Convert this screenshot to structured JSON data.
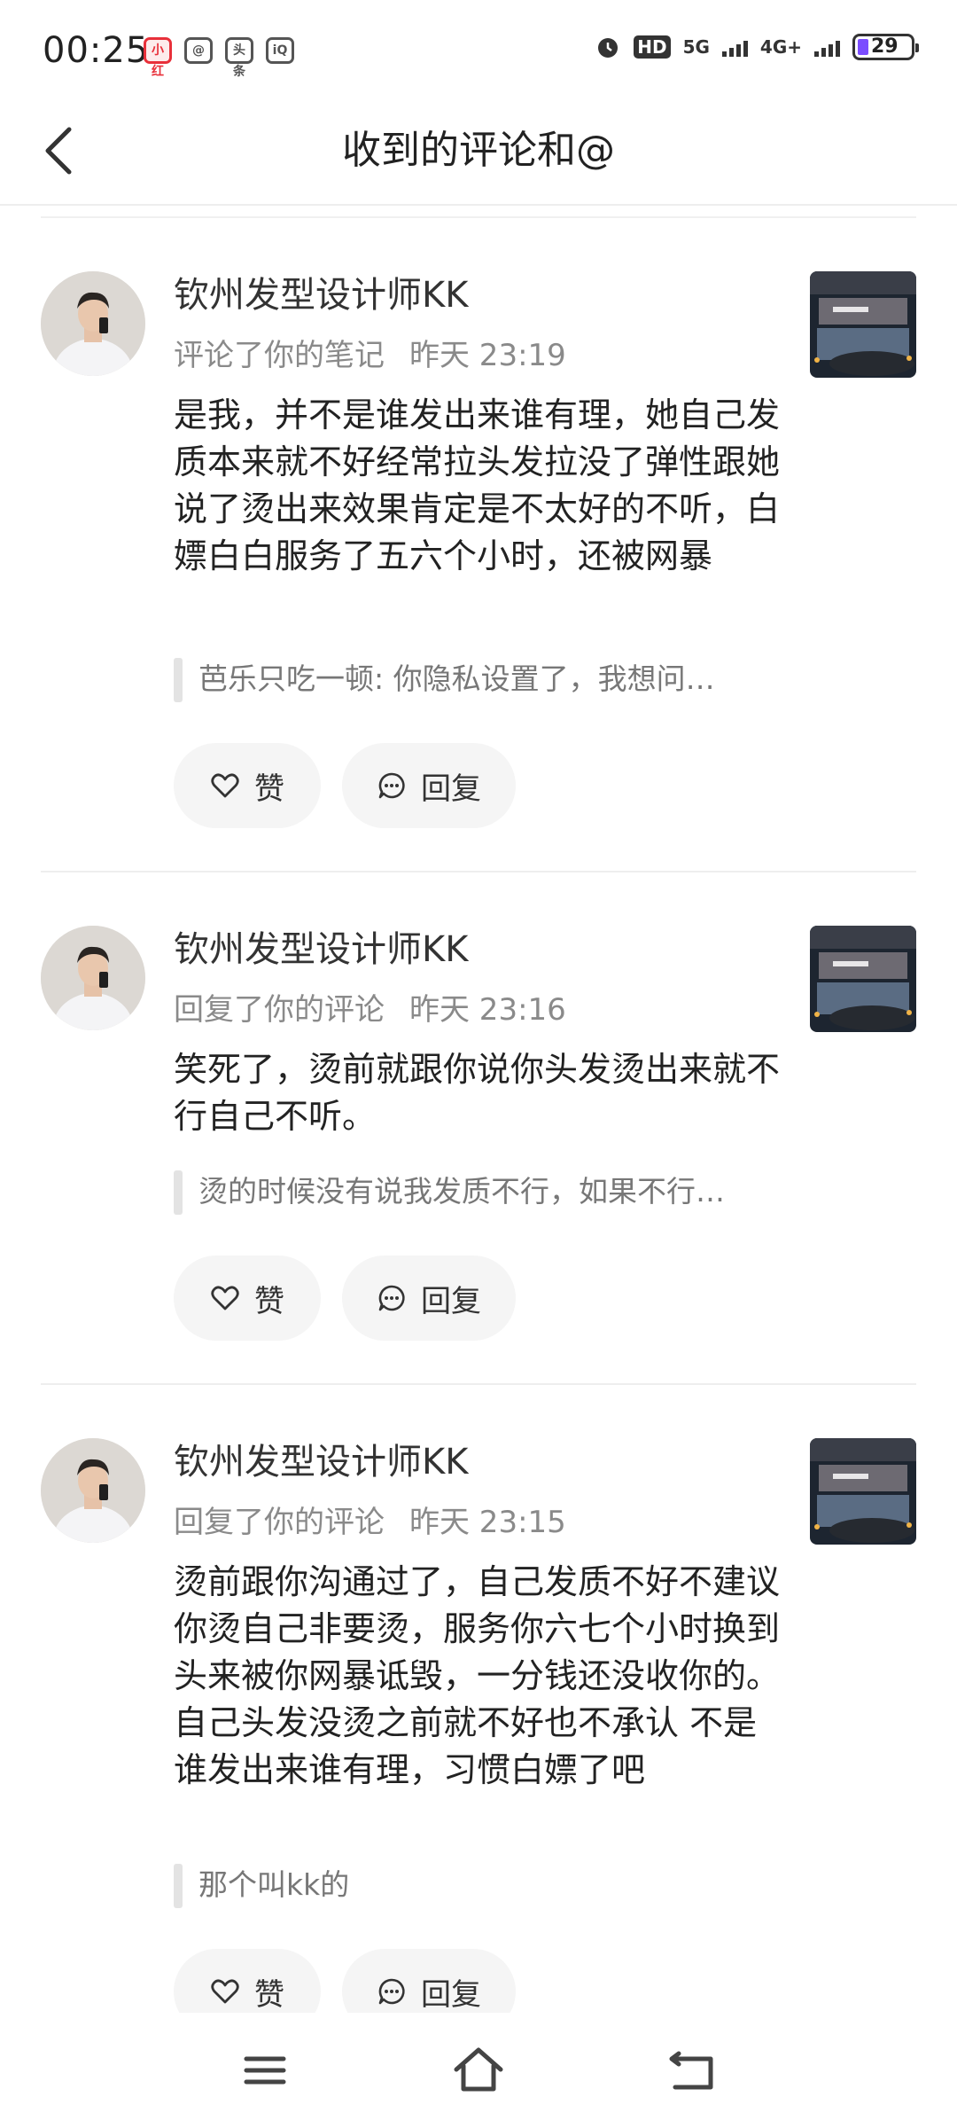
{
  "status_bar": {
    "time": "00:25",
    "app_icons": [
      "小红书",
      "@",
      "头条",
      "iQIYI"
    ],
    "hd_label": "HD",
    "network_5g": "5G",
    "network_4g": "4G+",
    "battery": "29"
  },
  "header": {
    "title": "收到的评论和@"
  },
  "items": [
    {
      "username": "钦州发型设计师KK",
      "action": "评论了你的笔记",
      "time": "昨天 23:19",
      "content": "是我，并不是谁发出来谁有理，她自己发质本来就不好经常拉头发拉没了弹性跟她说了烫出来效果肯定是不太好的不听，白嫖白白服务了五六个小时，还被网暴",
      "quote": "芭乐只吃一顿: 你隐私设置了，我想问…",
      "like_label": "赞",
      "reply_label": "回复"
    },
    {
      "username": "钦州发型设计师KK",
      "action": "回复了你的评论",
      "time": "昨天 23:16",
      "content": "笑死了，烫前就跟你说你头发烫出来就不行自己不听。",
      "quote": "烫的时候没有说我发质不行，如果不行…",
      "like_label": "赞",
      "reply_label": "回复"
    },
    {
      "username": "钦州发型设计师KK",
      "action": "回复了你的评论",
      "time": "昨天 23:15",
      "content": "烫前跟你沟通过了，自己发质不好不建议你烫自己非要烫，服务你六七个小时换到头来被你网暴诋毁，一分钱还没收你的。自己头发没烫之前就不好也不承认 不是谁发出来谁有理，习惯白嫖了吧",
      "quote": "那个叫kk的",
      "like_label": "赞",
      "reply_label": "回复"
    }
  ],
  "colors": {
    "secondary_text": "#8a8a8a",
    "pill_bg": "#f5f5f5",
    "divider": "#eeeeee",
    "battery_fill": "#7b4dff"
  },
  "icons": {
    "back": "chevron-left-icon",
    "like": "heart-icon",
    "reply": "comment-icon",
    "menu": "menu-icon",
    "home": "home-icon",
    "back_nav": "back-arrow-icon"
  }
}
